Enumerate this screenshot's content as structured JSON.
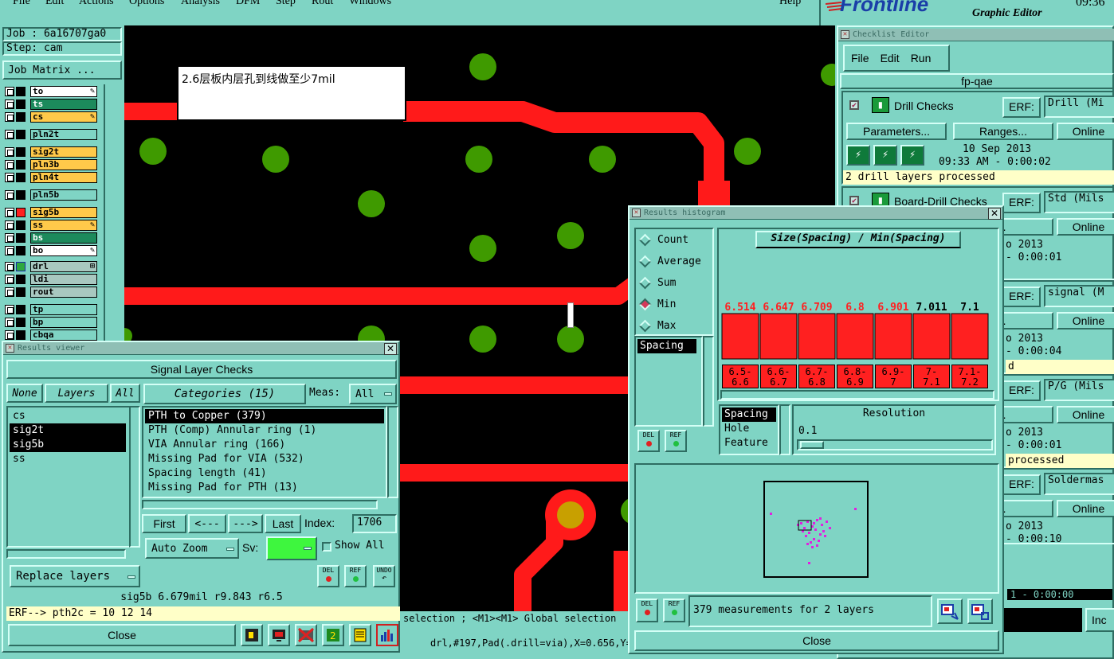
{
  "menu": {
    "file": "File",
    "edit": "Edit",
    "actions": "Actions",
    "options": "Options",
    "analysis": "Analysis",
    "dfm": "DFM",
    "step": "Step",
    "rout": "Rout",
    "windows": "Windows",
    "help": "Help"
  },
  "brand": {
    "logo": "Frontline",
    "subtitle": "Graphic Editor",
    "clock": "09:36"
  },
  "job": {
    "job_line": "Job : 6a16707ga0",
    "step_line": "Step: cam",
    "matrix_btn": "Job Matrix ..."
  },
  "layers": [
    "to",
    "ts",
    "cs",
    "pln2t",
    "sig2t",
    "pln3b",
    "pln4t",
    "pln5b",
    "sig5b",
    "ss",
    "bs",
    "bo",
    "drl",
    "ldi",
    "rout",
    "tp",
    "bp",
    "cbqa"
  ],
  "note": {
    "text": "2.6层板内层孔到线做至少7mil"
  },
  "canvas_status": {
    "line1": "selection ; <M1><M1> Global selection",
    "line2": "drl,#197,Pad(.drill=via),X=0.656,Y="
  },
  "results_viewer": {
    "title": "Results viewer",
    "header": "Signal Layer Checks",
    "none": "None",
    "layers": "Layers",
    "all": "All",
    "categories": "Categories (15)",
    "meas_label": "Meas:",
    "meas_value": "All",
    "layer_items": [
      "cs",
      "sig2t",
      "sig5b",
      "ss"
    ],
    "category_items": [
      "PTH to Copper (379)",
      "PTH (Comp) Annular ring (1)",
      "VIA Annular ring (166)",
      "Missing Pad for VIA (532)",
      "Spacing length (41)",
      "Missing Pad for PTH (13)"
    ],
    "first": "First",
    "prev": "<---",
    "next": "--->",
    "last": "Last",
    "index_label": "Index:",
    "index_value": "1706",
    "auto_zoom": "Auto Zoom",
    "sv_label": "Sv:",
    "show_all": "Show All",
    "replace_layers": "Replace layers",
    "del": "DEL",
    "ref": "REF",
    "undo": "UNDO",
    "status": "sig5b 6.679mil  r9.843  r6.5",
    "erf": "ERF--> pth2c = 10 12 14",
    "close": "Close"
  },
  "histogram": {
    "title": "Results histogram",
    "modes": [
      "Count",
      "Average",
      "Sum",
      "Min",
      "Max"
    ],
    "selected_mode": "Min",
    "measure_list": [
      "Spacing"
    ],
    "chart_title": "Size(Spacing) / Min(Spacing)",
    "bins": [
      "6.5-6.6",
      "6.6-6.7",
      "6.7-6.8",
      "6.8-6.9",
      "6.9-7",
      "7-7.1",
      "7.1-7.2"
    ],
    "bin_top": [
      "6.5-",
      "6.6-",
      "6.7-",
      "6.8-",
      "6.9-",
      "7-",
      "7.1-"
    ],
    "bin_bot": [
      "6.6",
      "6.7",
      "6.8",
      "6.9",
      "7",
      "7.1",
      "7.2"
    ],
    "axis_items": [
      "Spacing",
      "Hole",
      "Feature"
    ],
    "resolution_label": "Resolution",
    "resolution_value": "0.1",
    "del": "DEL",
    "ref": "REF",
    "summary": "379 measurements for 2 layers",
    "close": "Close"
  },
  "chart_data": {
    "type": "bar",
    "title": "Size(Spacing) / Min(Spacing)",
    "categories": [
      "6.5-6.6",
      "6.6-6.7",
      "6.7-6.8",
      "6.8-6.9",
      "6.9-7",
      "7-7.1",
      "7.1-7.2"
    ],
    "values": [
      6.514,
      6.647,
      6.709,
      6.8,
      6.901,
      7.011,
      7.1
    ],
    "label_colors": [
      "#ff2020",
      "#ff2020",
      "#ff2020",
      "#ff2020",
      "#ff2020",
      "#000000",
      "#000000"
    ],
    "xlabel": "",
    "ylabel": ""
  },
  "checklist": {
    "title": "Checklist Editor",
    "menu_file": "File",
    "menu_edit": "Edit",
    "menu_run": "Run",
    "name": "fp-qae",
    "erf_label": "ERF:",
    "checks": [
      {
        "name": "Drill Checks",
        "erf": "Drill (Mi",
        "params": "Parameters...",
        "ranges": "Ranges...",
        "online": "Online",
        "date": "10 Sep 2013",
        "time": "09:33 AM - 0:00:02",
        "msg": "2 drill layers processed"
      },
      {
        "name": "Board-Drill Checks",
        "erf": "Std (Mils",
        "ranges": "es...",
        "online": "Online",
        "date": "o 2013",
        "time": "- 0:00:01"
      },
      {
        "erf": "signal (M",
        "ranges": "es...",
        "online": "Online",
        "date": "o 2013",
        "time": "- 0:00:04",
        "msg": "d"
      },
      {
        "erf": "P/G (Mils",
        "ranges": "es...",
        "online": "Online",
        "date": "o 2013",
        "time": "- 0:00:01",
        "msg": "processed"
      },
      {
        "erf": "Soldermas",
        "ranges": "es...",
        "online": "Online",
        "date": "o 2013",
        "time": "- 0:00:10"
      }
    ],
    "bottom_value": "1 - 0:00:00",
    "inc": "Inc"
  },
  "colors": {
    "bg": "#7fd4c4",
    "copper": "#ff1a1a",
    "pad": "#3f9a00",
    "drill": "#c8a000",
    "select": "#000000"
  }
}
